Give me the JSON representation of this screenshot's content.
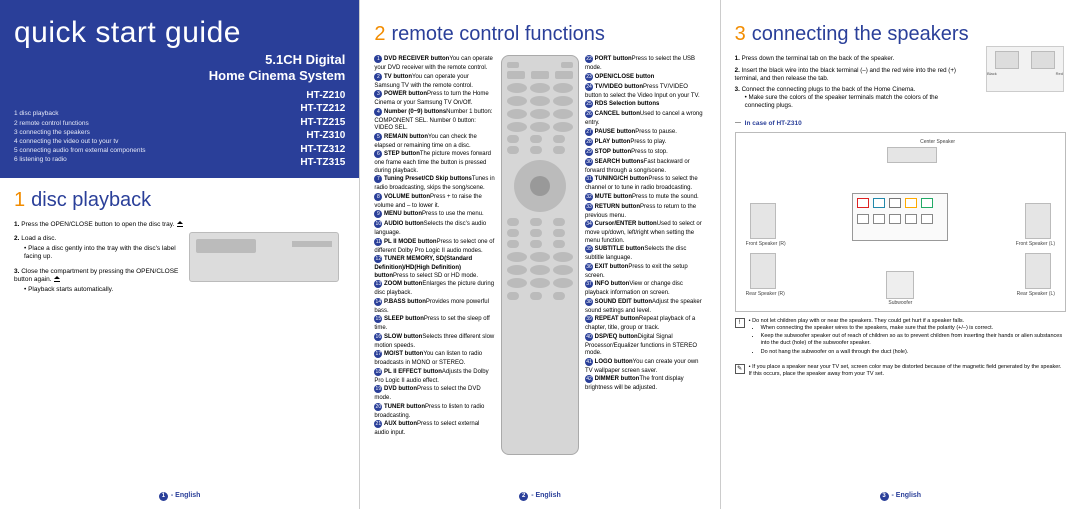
{
  "page1": {
    "cover_title": "quick start guide",
    "subtitle_1": "5.1CH Digital",
    "subtitle_2": "Home Cinema System",
    "models": [
      "HT-Z210",
      "HT-TZ212",
      "HT-TZ215",
      "HT-Z310",
      "HT-TZ312",
      "HT-TZ315"
    ],
    "toc": [
      "1 disc playback",
      "2 remote control functions",
      "3 connecting the speakers",
      "4 connecting the video out to your tv",
      "5 connecting audio from external components",
      "6 listening to radio"
    ],
    "sec_num": "1",
    "sec_title": "disc playback",
    "step1": "Press the OPEN/CLOSE button to open the disc tray.",
    "step2": "Load a disc.",
    "step2_sub": "Place a disc gently into the tray with the disc's label facing up.",
    "step3": "Close the compartment by pressing the OPEN/CLOSE button again.",
    "step3_sub": "Playback starts automatically.",
    "footer": "- English"
  },
  "page2": {
    "sec_num": "2",
    "sec_title": "remote control functions",
    "left": [
      {
        "t": "DVD RECEIVER button",
        "d": "You can operate your DVD receiver with the remote control."
      },
      {
        "t": "TV button",
        "d": "You can operate your Samsung TV with the remote control."
      },
      {
        "t": "POWER button",
        "d": "Press to turn the Home Cinema or your Samsung TV On/Off."
      },
      {
        "t": "Number (0~9) buttons",
        "d": "Number 1 button: COMPONENT SEL. Number 0 button: VIDEO SEL."
      },
      {
        "t": "REMAIN button",
        "d": "You can check the elapsed or remaining time on a disc."
      },
      {
        "t": "STEP button",
        "d": "The picture moves forward one frame each time the button is pressed during playback."
      },
      {
        "t": "Tuning Preset/CD Skip buttons",
        "d": "Tunes in radio broadcasting, skips the song/scene."
      },
      {
        "t": "VOLUME button",
        "d": "Press + to raise the volume and – to lower it."
      },
      {
        "t": "MENU button",
        "d": "Press to use the menu."
      },
      {
        "t": "AUDIO button",
        "d": "Selects the disc's audio language."
      },
      {
        "t": "PL II MODE button",
        "d": "Press to select one of different Dolby Pro Logic II audio modes."
      },
      {
        "t": "TUNER MEMORY, SD(Standard Definition)/HD(High Definition) button",
        "d": "Press to select SD or HD mode."
      },
      {
        "t": "ZOOM button",
        "d": "Enlarges the picture during disc playback."
      },
      {
        "t": "P.BASS button",
        "d": "Provides more powerful bass."
      },
      {
        "t": "SLEEP button",
        "d": "Press to set the sleep off time."
      },
      {
        "t": "SLOW button",
        "d": "Selects three different slow motion speeds."
      },
      {
        "t": "MO/ST button",
        "d": "You can listen to radio broadcasts in MONO or STEREO."
      },
      {
        "t": "PL II EFFECT button",
        "d": "Adjusts the Dolby Pro Logic II audio effect."
      },
      {
        "t": "DVD button",
        "d": "Press to select the DVD mode."
      },
      {
        "t": "TUNER button",
        "d": "Press to listen to radio broadcasting."
      },
      {
        "t": "AUX button",
        "d": "Press to select external audio input."
      }
    ],
    "right": [
      {
        "t": "PORT button",
        "d": "Press to select the USB mode."
      },
      {
        "t": "OPEN/CLOSE button",
        "d": ""
      },
      {
        "t": "TV/VIDEO button",
        "d": "Press TV/VIDEO button to select the Video Input on your TV."
      },
      {
        "t": "RDS Selection buttons",
        "d": ""
      },
      {
        "t": "CANCEL button",
        "d": "Used to cancel a wrong entry."
      },
      {
        "t": "PAUSE button",
        "d": "Press to pause."
      },
      {
        "t": "PLAY button",
        "d": "Press to play."
      },
      {
        "t": "STOP button",
        "d": "Press to stop."
      },
      {
        "t": "SEARCH buttons",
        "d": "Fast backward or forward through a song/scene."
      },
      {
        "t": "TUNING/CH button",
        "d": "Press to select the channel or to tune in radio broadcasting."
      },
      {
        "t": "MUTE button",
        "d": "Press to mute the sound."
      },
      {
        "t": "RETURN button",
        "d": "Press to return to the previous menu."
      },
      {
        "t": "Cursor/ENTER button",
        "d": "Used to select or move up/down, left/right when setting the menu function."
      },
      {
        "t": "SUBTITLE button",
        "d": "Selects the disc subtitle language."
      },
      {
        "t": "EXIT button",
        "d": "Press to exit the setup screen."
      },
      {
        "t": "INFO button",
        "d": "View or change disc playback information on screen."
      },
      {
        "t": "SOUND EDIT button",
        "d": "Adjust the speaker sound settings and level."
      },
      {
        "t": "REPEAT button",
        "d": "Repeat playback of a chapter, title, group or track."
      },
      {
        "t": "DSP/EQ button",
        "d": "Digital Signal Processor/Equalizer functions in STEREO mode."
      },
      {
        "t": "LOGO button",
        "d": "You can create your own TV wallpaper screen saver."
      },
      {
        "t": "DIMMER button",
        "d": "The front display brightness will be adjusted."
      }
    ],
    "footer": "- English"
  },
  "page3": {
    "sec_num": "3",
    "sec_title": "connecting the speakers",
    "step1": "Press down the terminal tab on the back of the speaker.",
    "step2": "Insert the black wire into the black terminal (–) and the red wire into the red (+) terminal, and then release the tab.",
    "step3": "Connect the connecting plugs to the back of the Home Cinema.",
    "step3_sub": "Make sure the colors of the speaker terminals match the colors of the connecting plugs.",
    "term_black": "Black",
    "term_red": "Red",
    "case_label": "In case of HT-Z310",
    "spk_center": "Center Speaker",
    "spk_fl": "Front Speaker (R)",
    "spk_fr": "Front Speaker (L)",
    "spk_rl": "Rear Speaker (R)",
    "spk_rr": "Rear Speaker (L)",
    "spk_sub": "Subwoofer",
    "note1_lead": "Do not let children play with or near the speakers. They could get hurt if a speaker falls.",
    "note1_b1": "When connecting the speaker wires to the speakers, make sure that the polarity (+/–) is correct.",
    "note1_b2": "Keep the subwoofer speaker out of reach of children so as to prevent children from inserting their hands or alien substances into the duct (hole) of the subwoofer speaker.",
    "note1_b3": "Do not hang the subwoofer on a wall through the duct (hole).",
    "note2": "If you place a speaker near your TV set, screen color may be distorted because of the magnetic field generated by the speaker. If this occurs, place the speaker away from your TV set.",
    "footer": "- English"
  }
}
